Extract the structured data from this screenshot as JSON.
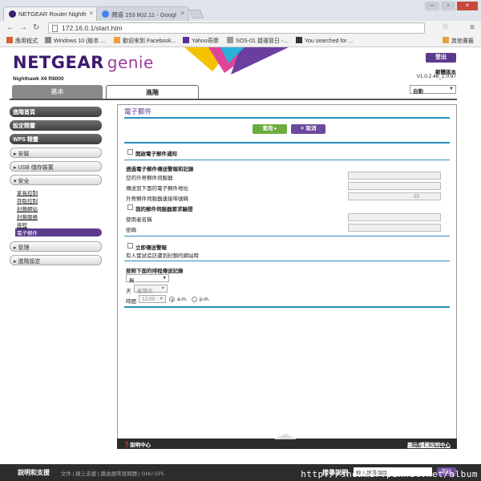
{
  "browser": {
    "tabs": [
      {
        "title": "NETGEAR Router Nighth"
      },
      {
        "title": "頻道 153 802.11 - Googl"
      }
    ],
    "url": "172.16.0.1/start.htm",
    "bookmarks": [
      "應用程式",
      "Windows 10 (版本 ...",
      "歡迎來到 Facebook...",
      "Yahoo奇摩",
      "SOS-01 捷運晉日 -...",
      "You searched for ...",
      "其他書籤"
    ]
  },
  "header": {
    "logo": "NETGEAR",
    "logo_genie": "genie",
    "model": "Nighthawk X6 R8000",
    "logout": "登出",
    "firmware_label": "韌體版本",
    "firmware_version": "V1.0.2.46_1.0.97",
    "language": "自動"
  },
  "main_tabs": {
    "basic": "基本",
    "advanced": "進階"
  },
  "sidebar": {
    "home": "進階首頁",
    "setup": "設定精靈",
    "wps": "WPS 精靈",
    "install": "▸ 安裝",
    "usb": "▸ USB 儲存裝置",
    "security": "▾ 安全",
    "security_items": [
      "家長控制",
      "存取控制",
      "封鎖網站",
      "封鎖服務",
      "排程",
      "電子郵件"
    ],
    "management": "▸ 管理",
    "advanced_setup": "▸ 進階設定"
  },
  "content": {
    "title": "電子郵件",
    "apply": "套用 ▸",
    "cancel": "✕ 取消",
    "enable_notify": "開啟電子郵件通知",
    "section_send": "透過電子郵件傳送警報和記錄",
    "outgoing_server": "您的外寄郵件伺服器",
    "to_address": "傳送到下面的電子郵件地址",
    "port_label": "外寄郵件伺服器連接埠號碼",
    "port_value": "25",
    "auth_required": "我的郵件伺服器要求驗證",
    "username": "使用者名稱",
    "password": "密碼",
    "send_alerts_now": "立即傳送警報",
    "alert_desc": "有人嘗試造訪遭到封鎖的網站時",
    "schedule_label": "按照下面的排程傳送記錄",
    "frequency": "無",
    "day_label": "天",
    "day_value": "星期天",
    "time_label": "時間",
    "time_value": "12:00",
    "am": "a.m.",
    "pm": "p.m."
  },
  "help_bar": {
    "left": "❓說明中心",
    "right": "顯示/隱藏說明中心"
  },
  "footer": {
    "support": "說明和支援",
    "links": "文件 | 線上支援 | 路由器常見問題 | GNU GPL",
    "search_label": "搜尋說明",
    "search_placeholder": "輸入搜尋項目",
    "search_go": "前往"
  },
  "watermark": "http://showmer.pixnet.net/album"
}
